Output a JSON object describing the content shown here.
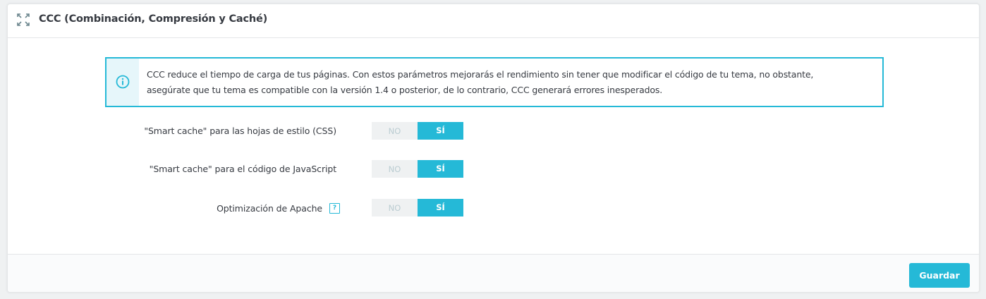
{
  "panel": {
    "title": "CCC (Combinación, Compresión y Caché)",
    "heading_icon": "expand-icon"
  },
  "alert": {
    "icon": "info-icon",
    "line1": "CCC reduce el tiempo de carga de tus páginas. Con estos parámetros mejorarás el rendimiento sin tener que modificar el código de tu tema, no obstante,",
    "line2": "asegúrate que tu tema es compatible con la versión 1.4 o posterior, de lo contrario, CCC generará errores inesperados."
  },
  "settings": [
    {
      "label": "\"Smart cache\" para las hojas de estilo (CSS)",
      "no": "NO",
      "yes": "SÍ",
      "value": "SÍ"
    },
    {
      "label": "\"Smart cache\" para el código de JavaScript",
      "no": "NO",
      "yes": "SÍ",
      "value": "SÍ"
    },
    {
      "label": "Optimización de Apache",
      "no": "NO",
      "yes": "SÍ",
      "value": "SÍ",
      "help": "?"
    }
  ],
  "footer": {
    "save_label": "Guardar"
  },
  "colors": {
    "accent": "#25b9d7",
    "alert_bg": "#e6f6fa",
    "toggle_off_bg": "#eff1f2",
    "text": "#363a41"
  }
}
